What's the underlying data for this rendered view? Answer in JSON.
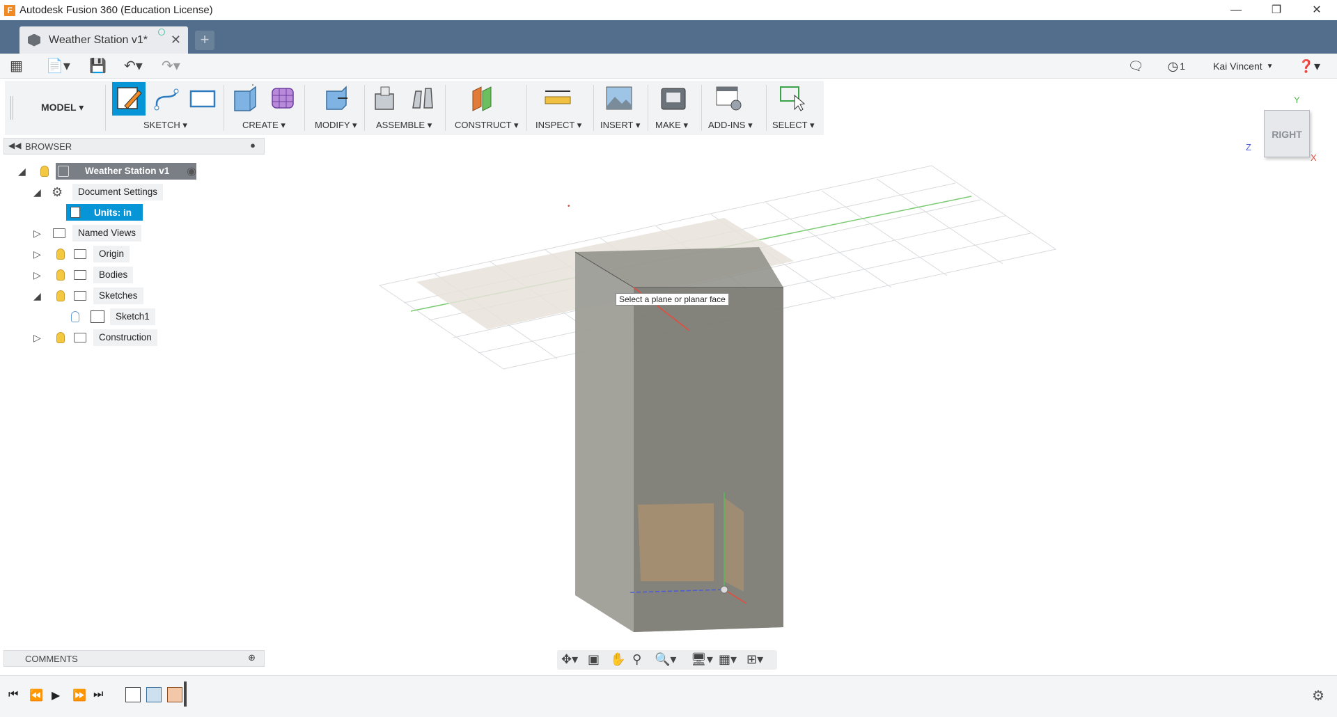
{
  "app": {
    "title": "Autodesk Fusion 360 (Education License)"
  },
  "tabs": [
    {
      "label": "Weather Station v1*"
    }
  ],
  "quick_access": {
    "jobs_count": "1",
    "user_name": "Kai Vincent"
  },
  "toolbar": {
    "workspace": "MODEL",
    "groups": [
      {
        "label": "SKETCH"
      },
      {
        "label": "CREATE"
      },
      {
        "label": "MODIFY"
      },
      {
        "label": "ASSEMBLE"
      },
      {
        "label": "CONSTRUCT"
      },
      {
        "label": "INSPECT"
      },
      {
        "label": "INSERT"
      },
      {
        "label": "MAKE"
      },
      {
        "label": "ADD-INS"
      },
      {
        "label": "SELECT"
      }
    ]
  },
  "browser": {
    "title": "BROWSER",
    "root": "Weather Station v1",
    "items": [
      {
        "label": "Document Settings"
      },
      {
        "label": "Units: in"
      },
      {
        "label": "Named Views"
      },
      {
        "label": "Origin"
      },
      {
        "label": "Bodies"
      },
      {
        "label": "Sketches"
      },
      {
        "label": "Sketch1"
      },
      {
        "label": "Construction"
      }
    ]
  },
  "comments": {
    "title": "COMMENTS"
  },
  "viewport": {
    "tooltip": "Select a plane or planar face"
  },
  "viewcube": {
    "face": "RIGHT",
    "axis_x": "X",
    "axis_y": "Y",
    "axis_z": "Z"
  },
  "colors": {
    "tabbar": "#536e8c",
    "selection": "#0696d7",
    "accent": "#f08a24"
  }
}
